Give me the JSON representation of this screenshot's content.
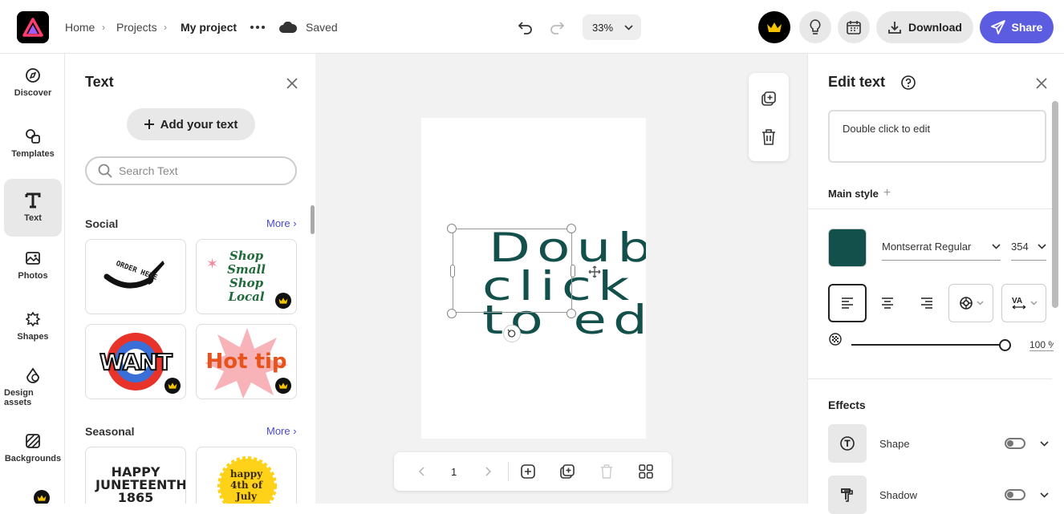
{
  "header": {
    "breadcrumbs": [
      "Home",
      "Projects",
      "My project"
    ],
    "save_status": "Saved",
    "zoom": "33%",
    "download_label": "Download",
    "share_label": "Share"
  },
  "rail": {
    "items": [
      {
        "label": "Discover",
        "icon": "compass-icon"
      },
      {
        "label": "Templates",
        "icon": "templates-icon"
      },
      {
        "label": "Text",
        "icon": "text-icon",
        "active": true
      },
      {
        "label": "Photos",
        "icon": "photo-icon"
      },
      {
        "label": "Shapes",
        "icon": "shapes-icon"
      },
      {
        "label": "Design assets",
        "icon": "design-assets-icon"
      },
      {
        "label": "Backgrounds",
        "icon": "backgrounds-icon"
      }
    ]
  },
  "text_panel": {
    "title": "Text",
    "add_label": "Add your text",
    "search_placeholder": "Search Text",
    "sections": [
      {
        "title": "Social",
        "more": "More",
        "cards": [
          {
            "text": "ORDER HERE",
            "premium": false
          },
          {
            "text": "Shop Small Shop Local",
            "premium": true
          },
          {
            "text": "WANT",
            "premium": true
          },
          {
            "text": "Hot tip",
            "premium": true
          }
        ]
      },
      {
        "title": "Seasonal",
        "more": "More",
        "cards": [
          {
            "text": "HAPPY JUNETEENTH 1865",
            "premium": false
          },
          {
            "text": "happy 4th of July",
            "premium": true
          }
        ]
      }
    ]
  },
  "canvas": {
    "text_lines": [
      "Doub",
      "click",
      "to ed"
    ],
    "text_color": "#13504c",
    "page_number": "1"
  },
  "edit_panel": {
    "title": "Edit text",
    "text_value": "Double click to edit",
    "main_style_label": "Main style",
    "font": "Montserrat Regular",
    "size": "354",
    "color": "#13504c",
    "opacity": "100 %",
    "effects_title": "Effects",
    "effects": [
      {
        "label": "Shape",
        "enabled": false
      },
      {
        "label": "Shadow",
        "enabled": false
      }
    ]
  }
}
